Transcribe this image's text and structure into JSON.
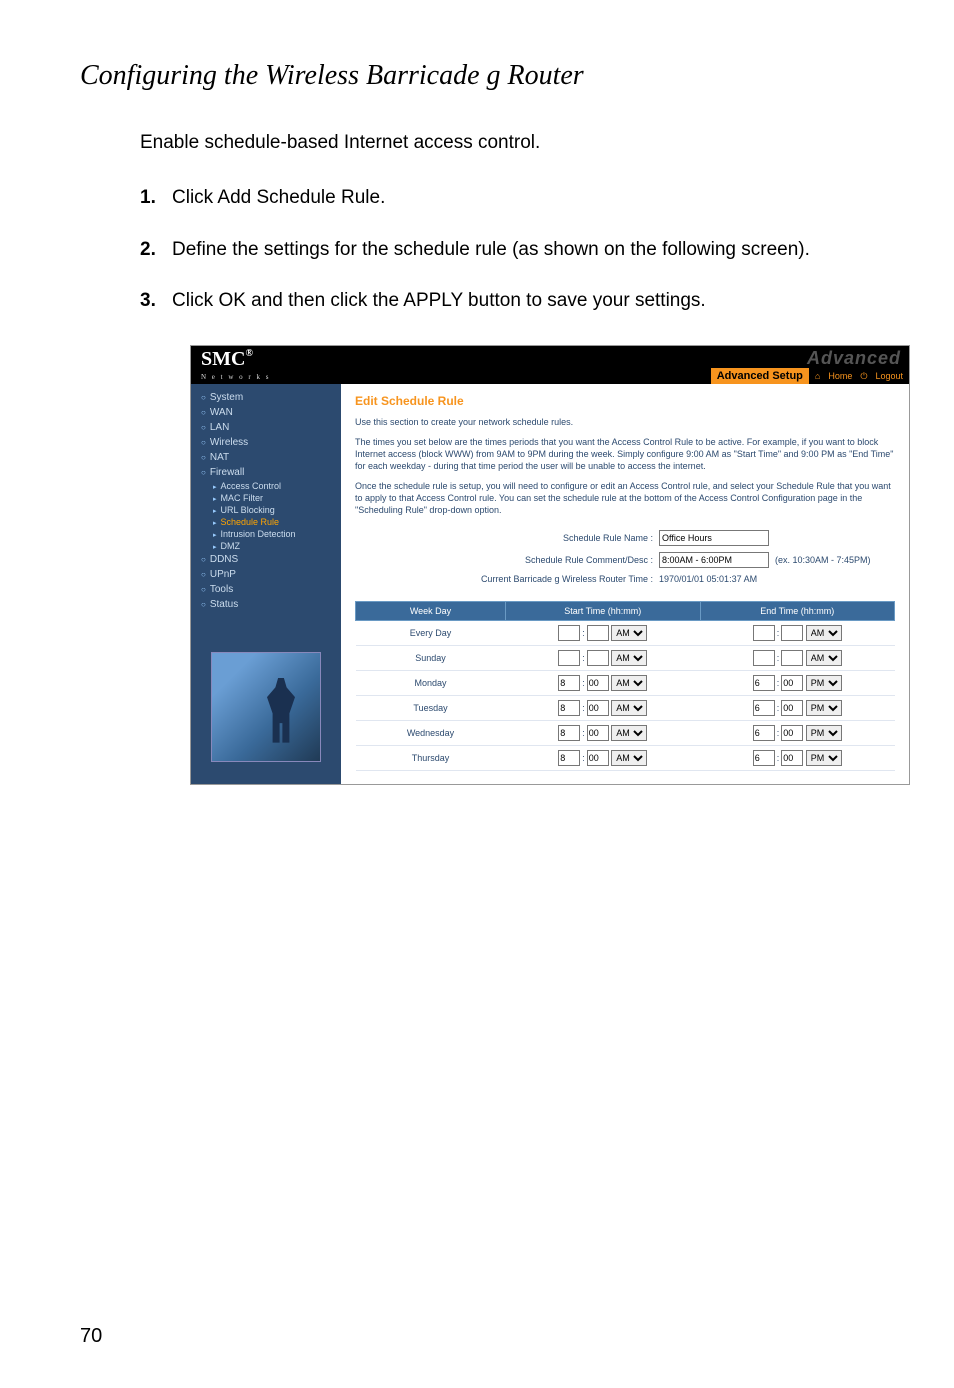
{
  "page": {
    "title": "Configuring the Wireless Barricade g Router",
    "intro": "Enable schedule-based Internet access control.",
    "page_number": "70",
    "steps": [
      {
        "n": "1.",
        "t": "Click Add Schedule Rule."
      },
      {
        "n": "2.",
        "t": "Define the settings for the schedule rule (as shown on the following screen)."
      },
      {
        "n": "3.",
        "t": "Click OK and then click the APPLY button to save your settings."
      }
    ]
  },
  "shot": {
    "logo": "SMC",
    "logo_reg": "®",
    "logo_sub": "N e t w o r k s",
    "ghost": "Advanced",
    "setup_label": "Advanced Setup",
    "home": "Home",
    "logout": "Logout",
    "nav": {
      "system": "System",
      "wan": "WAN",
      "lan": "LAN",
      "wireless": "Wireless",
      "nat": "NAT",
      "firewall": "Firewall",
      "fw_sub": {
        "ac": "Access Control",
        "mac": "MAC Filter",
        "url": "URL Blocking",
        "sched": "Schedule Rule",
        "intr": "Intrusion Detection",
        "dmz": "DMZ"
      },
      "ddns": "DDNS",
      "upnp": "UPnP",
      "tools": "Tools",
      "status": "Status"
    },
    "content": {
      "heading": "Edit Schedule Rule",
      "p1": "Use this section to create your network schedule rules.",
      "p2": "The times you set below are the times periods that you want the Access Control Rule to be active. For example, if you want to block Internet access (block WWW) from 9AM to 9PM during the week. Simply configure 9:00 AM as \"Start Time\" and 9:00 PM as \"End Time\" for each weekday - during that time period the user will be unable to access the internet.",
      "p3": "Once the schedule rule is setup, you will need to configure or edit an Access Control rule, and select your Schedule Rule that you want to apply to that Access Control rule. You can set the schedule rule at the bottom of the Access Control Configuration page in the \"Scheduling Rule\" drop-down option.",
      "labels": {
        "name": "Schedule Rule Name :",
        "comment": "Schedule Rule Comment/Desc :",
        "time": "Current Barricade g Wireless Router Time :"
      },
      "values": {
        "name": "Office Hours",
        "comment": "8:00AM - 6:00PM",
        "hint": "(ex. 10:30AM - 7:45PM)",
        "time": "1970/01/01 05:01:37 AM"
      },
      "table": {
        "headers": {
          "day": "Week Day",
          "start": "Start Time (hh:mm)",
          "end": "End Time (hh:mm)"
        },
        "rows": [
          {
            "day": "Every Day",
            "sh": "",
            "sm": "",
            "sap": "AM",
            "eh": "",
            "em": "",
            "eap": "AM"
          },
          {
            "day": "Sunday",
            "sh": "",
            "sm": "",
            "sap": "AM",
            "eh": "",
            "em": "",
            "eap": "AM"
          },
          {
            "day": "Monday",
            "sh": "8",
            "sm": "00",
            "sap": "AM",
            "eh": "6",
            "em": "00",
            "eap": "PM"
          },
          {
            "day": "Tuesday",
            "sh": "8",
            "sm": "00",
            "sap": "AM",
            "eh": "6",
            "em": "00",
            "eap": "PM"
          },
          {
            "day": "Wednesday",
            "sh": "8",
            "sm": "00",
            "sap": "AM",
            "eh": "6",
            "em": "00",
            "eap": "PM"
          },
          {
            "day": "Thursday",
            "sh": "8",
            "sm": "00",
            "sap": "AM",
            "eh": "6",
            "em": "00",
            "eap": "PM"
          }
        ]
      }
    }
  }
}
